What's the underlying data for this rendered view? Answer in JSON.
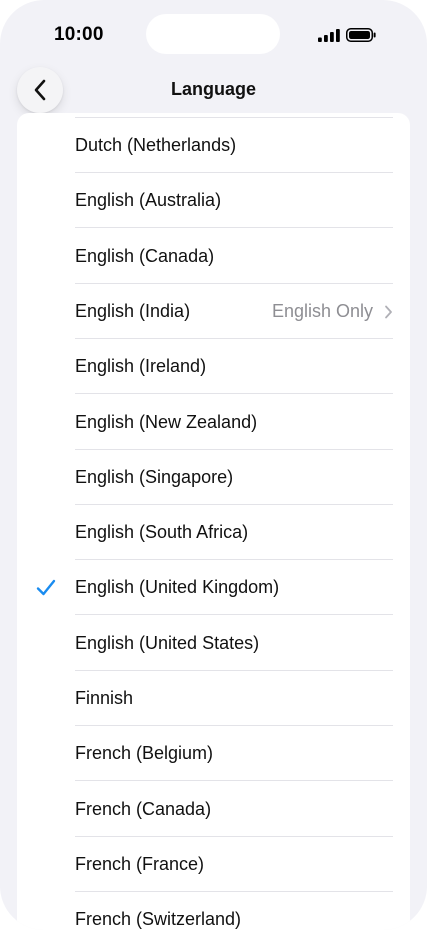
{
  "status_bar": {
    "time": "10:00"
  },
  "header": {
    "title": "Language"
  },
  "colors": {
    "accent": "#1a8cf0",
    "background": "#f2f2f7",
    "secondary_text": "#8e8e93"
  },
  "languages": [
    {
      "label": "Dutch (Netherlands)",
      "detail": "",
      "selected": false
    },
    {
      "label": "English (Australia)",
      "detail": "",
      "selected": false
    },
    {
      "label": "English (Canada)",
      "detail": "",
      "selected": false
    },
    {
      "label": "English (India)",
      "detail": "English Only",
      "selected": false
    },
    {
      "label": "English (Ireland)",
      "detail": "",
      "selected": false
    },
    {
      "label": "English (New Zealand)",
      "detail": "",
      "selected": false
    },
    {
      "label": "English (Singapore)",
      "detail": "",
      "selected": false
    },
    {
      "label": "English (South Africa)",
      "detail": "",
      "selected": false
    },
    {
      "label": "English (United Kingdom)",
      "detail": "",
      "selected": true
    },
    {
      "label": "English (United States)",
      "detail": "",
      "selected": false
    },
    {
      "label": "Finnish",
      "detail": "",
      "selected": false
    },
    {
      "label": "French (Belgium)",
      "detail": "",
      "selected": false
    },
    {
      "label": "French (Canada)",
      "detail": "",
      "selected": false
    },
    {
      "label": "French (France)",
      "detail": "",
      "selected": false
    },
    {
      "label": "French (Switzerland)",
      "detail": "",
      "selected": false
    }
  ]
}
